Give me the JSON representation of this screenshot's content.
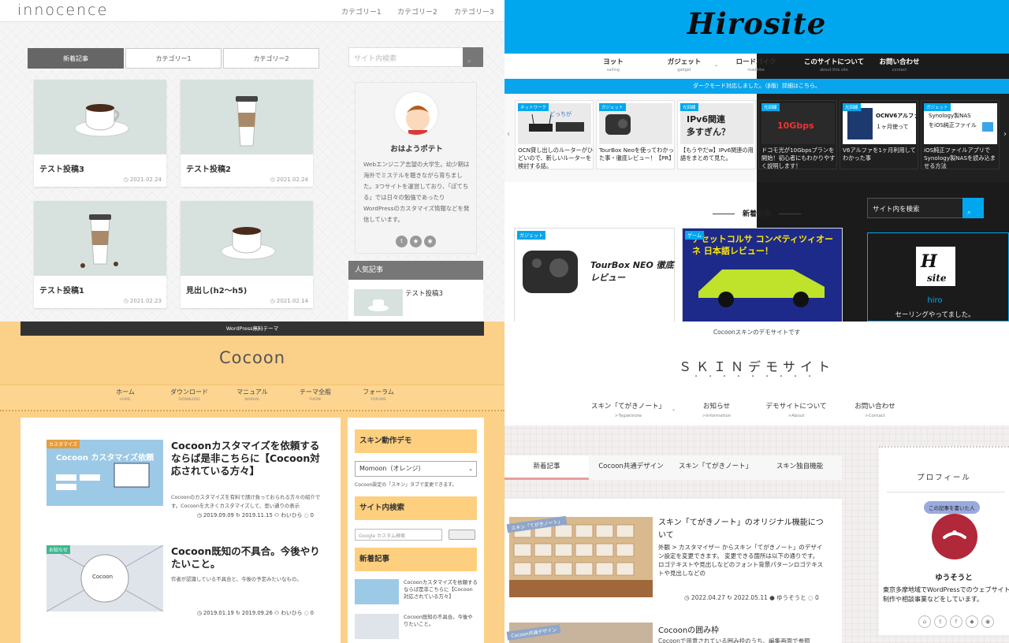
{
  "innocence": {
    "logo": "innocence",
    "nav": [
      "カテゴリー1",
      "カテゴリー2",
      "カテゴリー3"
    ],
    "tabs": [
      "新着記事",
      "カテゴリー1",
      "カテゴリー2"
    ],
    "cards": [
      {
        "title": "テスト投稿3",
        "date": "◷ 2021.02.24"
      },
      {
        "title": "テスト投稿2",
        "date": "◷ 2021.02.24"
      },
      {
        "title": "テスト投稿1",
        "date": "◷ 2021.02.23"
      },
      {
        "title": "見出し(h2〜h5)",
        "date": "◷ 2021.02.14"
      }
    ],
    "search_placeholder": "サイト内検索",
    "profile": {
      "name": "おはようポテト",
      "desc": "Webエンジニア志望の大学生。幼少期は海外でミステルを聴きながら育ちました。3つサイトを運営しており、「ぽてちる」では日々の勉強であったりWordPressのカスタマイズ情報などを発信しています。"
    },
    "popular_heading": "人気記事",
    "popular_item": "テスト投稿3"
  },
  "hirosite": {
    "logo": "Hirosite",
    "nav": [
      {
        "label": "ヨット",
        "sub": "sailing"
      },
      {
        "label": "ガジェット",
        "sub": "gadget"
      },
      {
        "label": "ロードバイク",
        "sub": "roadbike"
      },
      {
        "label": "このサイトについて",
        "sub": "about this site"
      },
      {
        "label": "お問い合わせ",
        "sub": "contact"
      }
    ],
    "notice": "ダークモード対応しました。（β版）詳細はこちら。",
    "slides": [
      {
        "label": "ネットワーク",
        "text": "OCN貸し出しのルーターがひどいので、新しいルーターを検討する話。"
      },
      {
        "label": "ガジェット",
        "text": "TourBox Neoを使ってわかった事・徹底レビュー！【PR】"
      },
      {
        "label": "光回線",
        "text": "【もうやだw】IPv6関連の用語をまとめて見た。"
      },
      {
        "label": "光回線",
        "text": "ドコモ光が10Gbpsプランを開始！初心者にもわかりやすく説明します！"
      },
      {
        "label": "光回線",
        "text": "V6アルファを1ヶ月利用してわかった事"
      },
      {
        "label": "ガジェット",
        "text": "iOS純正ファイルアプリでSynology製NASを読み込ませる方法"
      }
    ],
    "new_heading": "新着記事",
    "cards": [
      {
        "label": "ガジェット",
        "img_text": "TourBox NEO 徹底レビュー"
      },
      {
        "label": "ゲーム",
        "img_text": "アセットコルサ コンペティツィオーネ 日本語レビュー！"
      }
    ],
    "search_placeholder": "サイト内を検索",
    "profile": {
      "name": "hiro",
      "desc": "セーリングやってました。"
    }
  },
  "cocoon": {
    "topbar": "WordPress無料テーマ",
    "logo": "Cocoon",
    "nav": [
      {
        "label": "ホーム",
        "sub": "HOME"
      },
      {
        "label": "ダウンロード",
        "sub": "DOWNLOAD"
      },
      {
        "label": "マニュアル",
        "sub": "MANUAL"
      },
      {
        "label": "テーマ全般",
        "sub": "THEME"
      },
      {
        "label": "フォーラム",
        "sub": "FORUMS"
      }
    ],
    "entries": [
      {
        "label": "カスタマイズ",
        "img_text": "Cocoon カスタマイズ依頼",
        "title": "Cocoonカスタマイズを依頼するならば是非こちらに【Cocoon対応されている方々】",
        "desc": "Cocoonのカスタマイズを有料で請け負っておられる方々の紹介です。Cocoonを大きくカスタマイズして、思い通りの表示",
        "meta": "◷ 2019.09.09  ↻ 2019.11.15  ⚇ わいひら  ◌ 0"
      },
      {
        "label": "お知らせ",
        "img_text": "Cocoon",
        "title": "Cocoon既知の不具合。今後やりたいこと。",
        "desc": "作者が認識している不具合と、今後の予定みたいなもの。",
        "meta": "◷ 2019.01.19  ↻ 2019.09.26  ⚇ わいひら  ◌ 0"
      }
    ],
    "widgets": {
      "skin_heading": "スキン動作デモ",
      "skin_select": "Momoon（オレンジ）",
      "skin_note": "Cocoon設定の「スキン」タブで変更できます。",
      "search_heading": "サイト内検索",
      "search_placeholder": "Google カスタム検索",
      "search_button": "検索",
      "new_heading": "新着記事",
      "new_items": [
        "Cocoonカスタマイズを依頼するならば是非こちらに【Cocoon対応されている方々】",
        "Cocoon既知の不具合。今後やりたいこと。"
      ]
    }
  },
  "skin": {
    "badge": "Cocoonスキンのデモサイトです",
    "logo": "ＳＫＩＮデモサイト",
    "dots": "・・・・・・・・・",
    "nav": [
      {
        "label": "スキン「てがきノート」",
        "sub": ">Tegakinote"
      },
      {
        "label": "お知らせ",
        "sub": ">Information"
      },
      {
        "label": "デモサイトについて",
        "sub": ">About"
      },
      {
        "label": "お問い合わせ",
        "sub": ">Contact"
      }
    ],
    "tabs": [
      "新着記事",
      "Cocoon共通デザイン",
      "スキン「てがきノート」",
      "スキン独自機能"
    ],
    "article": {
      "label": "スキン「てがきノート」",
      "title": "スキン「てがきノート」のオリジナル機能について",
      "desc": "外観 > カスタマイザー からスキン「てがきノート」のデザイン設定を変更できます。 変更できる箇所は以下の通りです。 ロゴテキストや見出しなどのフォント背景パターンロゴテキストや見出しなどの",
      "meta": "◷ 2022.04.27  ↻ 2022.05.11  ● ゆうそうと  ◌ 0"
    },
    "article2": {
      "label": "Cocoon共通デザイン",
      "title": "Cocoonの囲み枠",
      "desc": "Cocoonで用意されている囲み枠のうち、編集画面で参照"
    },
    "profile": {
      "title": "プロフィール",
      "bubble": "この記事を書いた人",
      "name": "ゆうそうと",
      "desc": "東京多摩地域でWordPressでのウェブサイト制作や相談事業などをしています。"
    }
  }
}
